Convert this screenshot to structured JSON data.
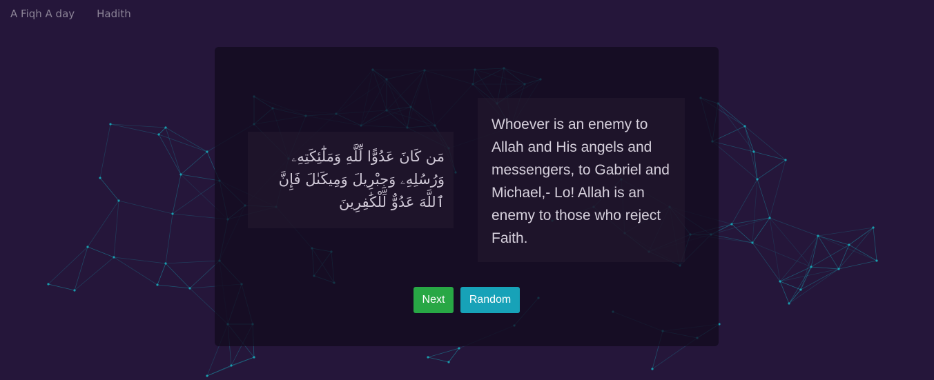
{
  "nav": {
    "brand": "A Fiqh A day",
    "links": [
      {
        "label": "Hadith"
      }
    ]
  },
  "verse": {
    "arabic": "مَن كَانَ عَدُوًّا لِّلَّهِ وَمَلَٰٓئِكَتِهِۦ وَرُسُلِهِۦ وَجِبْرِيلَ وَمِيكَىٰلَ فَإِنَّ ٱللَّهَ عَدُوٌّ لِّلْكَٰفِرِينَ",
    "translation": "Whoever is an enemy to Allah and His angels and messengers, to Gabriel and Michael,- Lo! Allah is an enemy to those who reject Faith."
  },
  "actions": {
    "next_label": "Next",
    "random_label": "Random"
  },
  "colors": {
    "background": "#25163a",
    "particles": "#19a7b8",
    "next": "#28a745",
    "random": "#17a2b8"
  }
}
